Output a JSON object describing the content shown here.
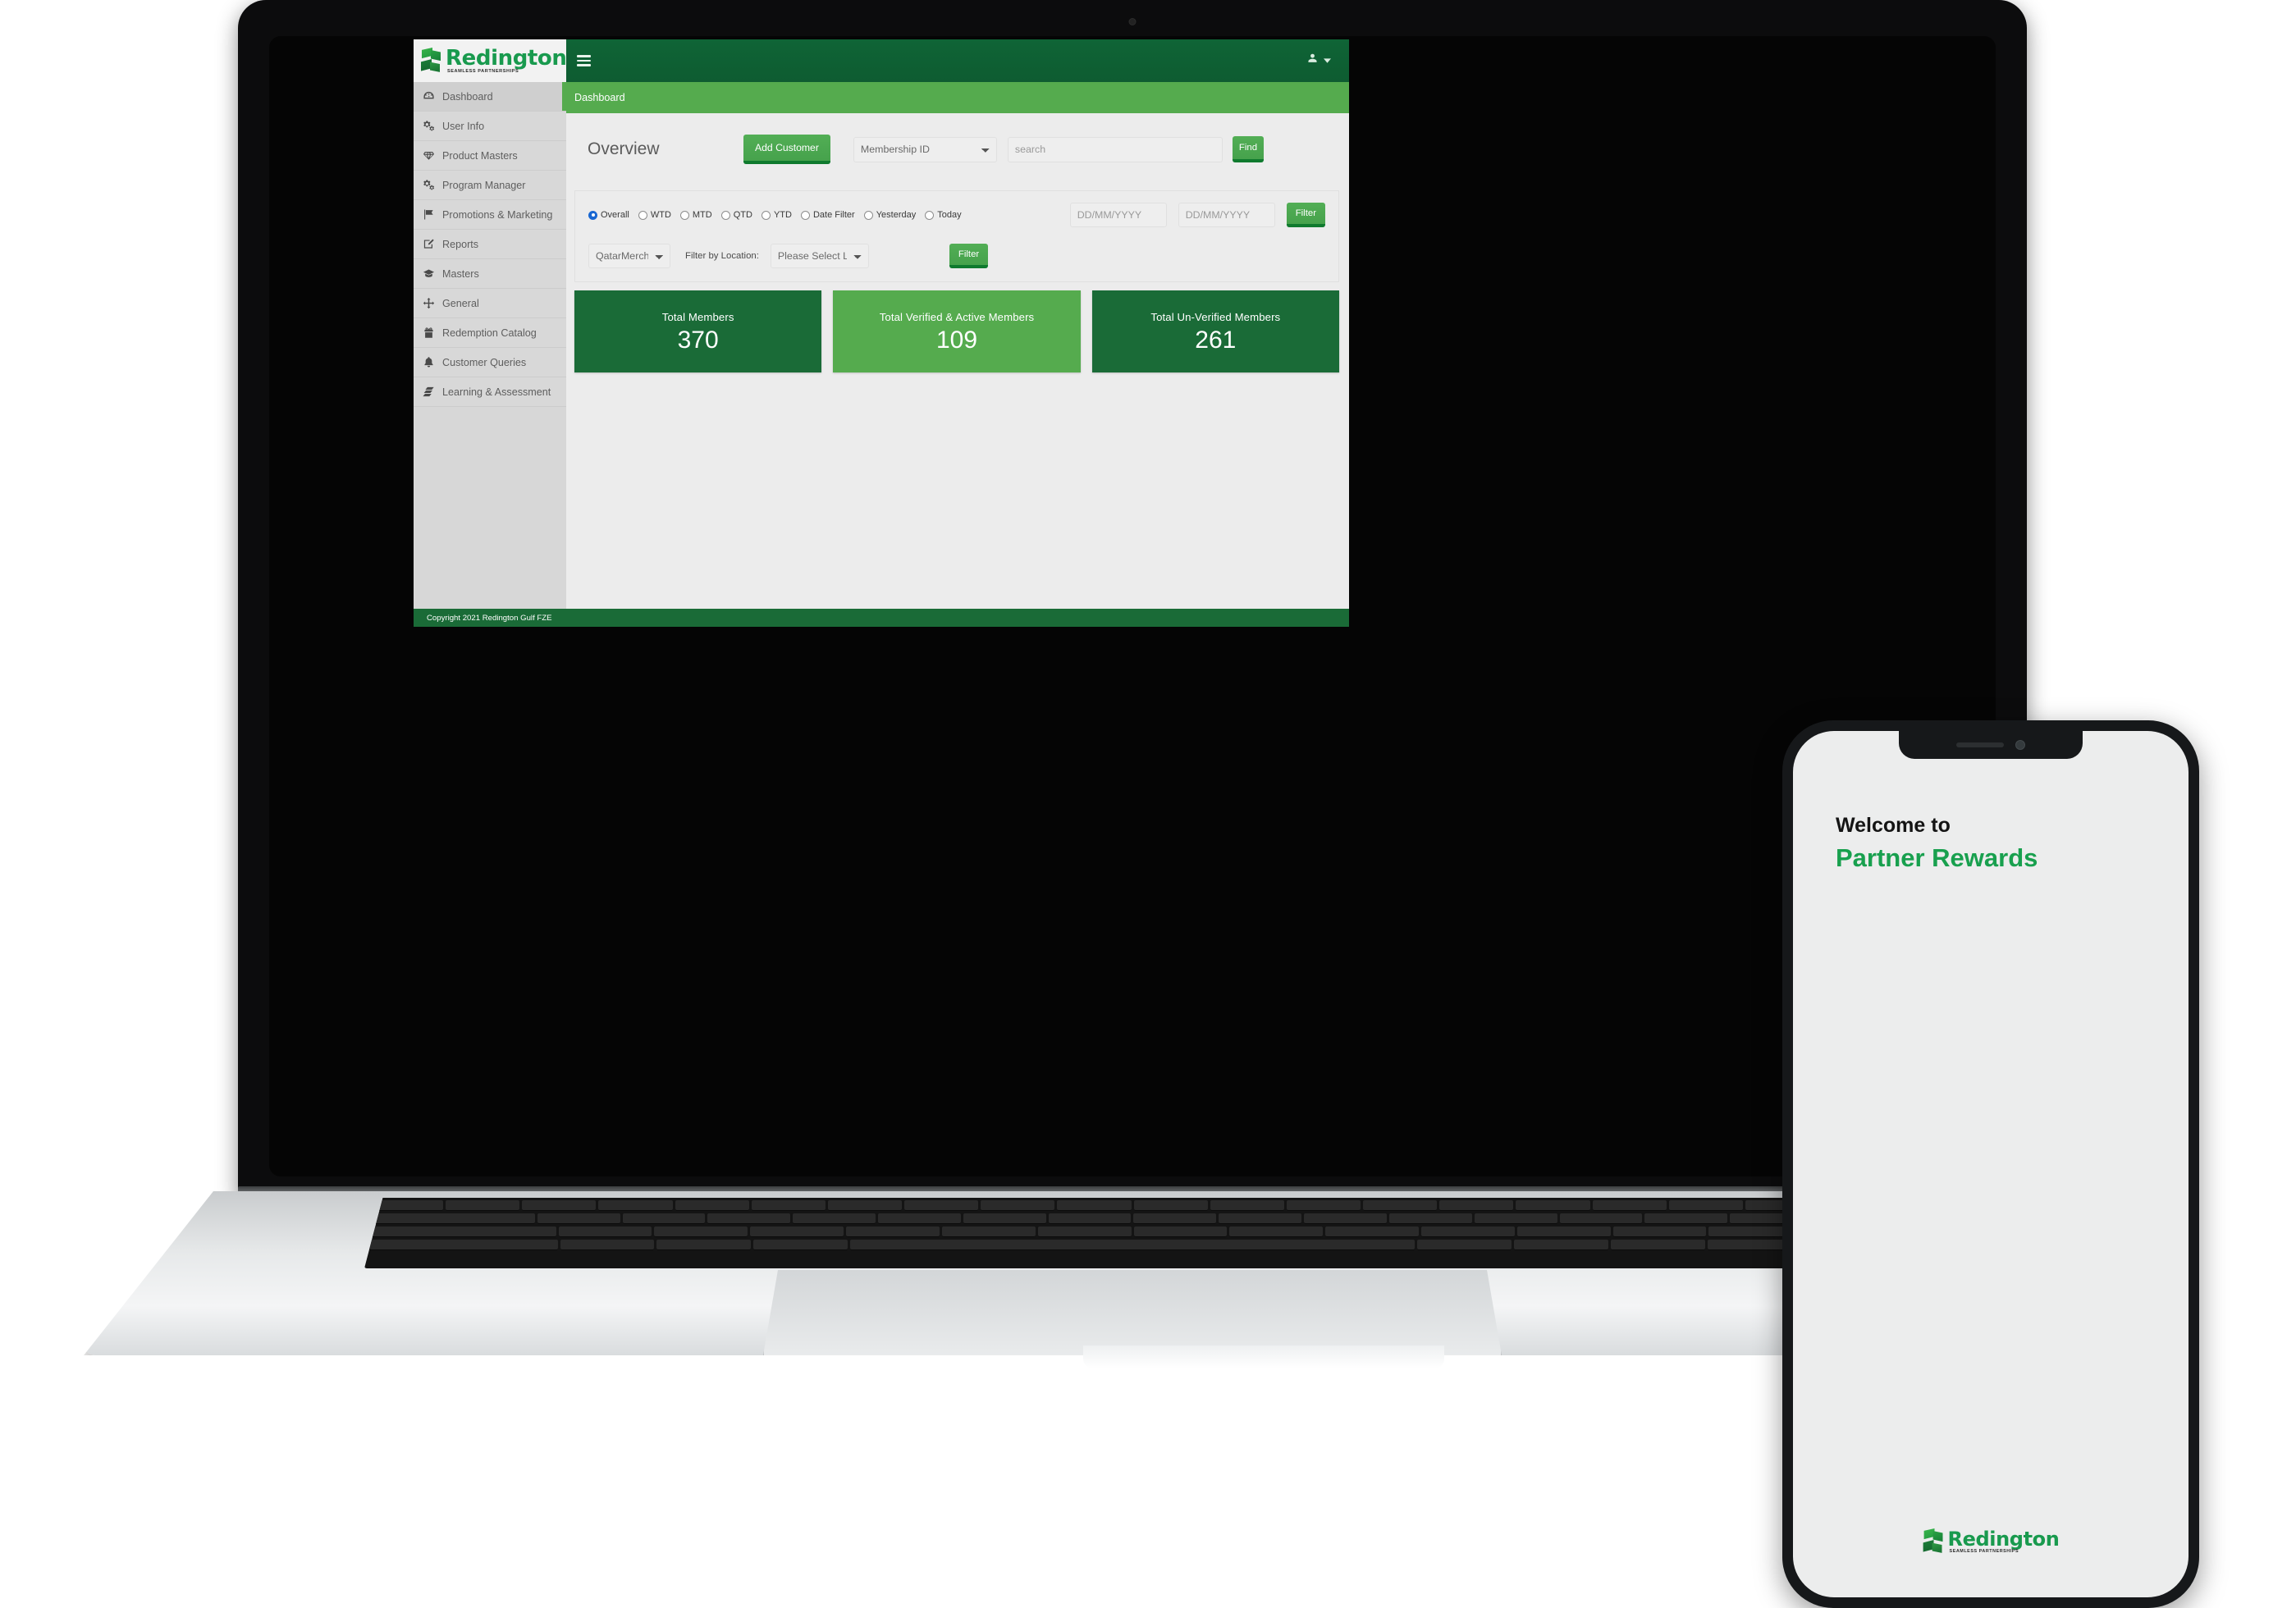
{
  "brand": {
    "name": "Redington",
    "tagline": "SEAMLESS PARTNERSHIPS",
    "mark_icon": "redington-logo-icon"
  },
  "colors": {
    "header_green": "#0f6436",
    "breadcrumb_green": "#55ab4e",
    "accent_green": "#18a04e",
    "card_dark": "#1a6b37",
    "card_light": "#55ab4e",
    "sidebar_bg": "#d7d7d7",
    "page_bg": "#ececec"
  },
  "sidebar": {
    "items": [
      {
        "label": "Dashboard",
        "icon": "dashboard-icon",
        "active": true
      },
      {
        "label": "User Info",
        "icon": "gears-icon",
        "active": false
      },
      {
        "label": "Product Masters",
        "icon": "diamond-icon",
        "active": false
      },
      {
        "label": "Program Manager",
        "icon": "gears-icon",
        "active": false
      },
      {
        "label": "Promotions & Marketing",
        "icon": "flag-icon",
        "active": false
      },
      {
        "label": "Reports",
        "icon": "edit-square-icon",
        "active": false
      },
      {
        "label": "Masters",
        "icon": "graduation-icon",
        "active": false
      },
      {
        "label": "General",
        "icon": "move-arrows-icon",
        "active": false
      },
      {
        "label": "Redemption Catalog",
        "icon": "gift-icon",
        "active": false
      },
      {
        "label": "Customer Queries",
        "icon": "bell-icon",
        "active": false
      },
      {
        "label": "Learning & Assessment",
        "icon": "book-icon",
        "active": false
      }
    ]
  },
  "topbar": {
    "menu_toggle_icon": "hamburger-icon",
    "user_icon": "user-avatar-icon",
    "user_caret_icon": "caret-down-icon"
  },
  "breadcrumb": {
    "label": "Dashboard"
  },
  "overview": {
    "title": "Overview",
    "add_customer_label": "Add Customer",
    "search_type_selected": "Membership ID",
    "search_type_options": [
      "Membership ID"
    ],
    "search_placeholder": "search",
    "search_value": "",
    "find_label": "Find"
  },
  "filters": {
    "period_options": [
      {
        "label": "Overall",
        "selected": true
      },
      {
        "label": "WTD",
        "selected": false
      },
      {
        "label": "MTD",
        "selected": false
      },
      {
        "label": "QTD",
        "selected": false
      },
      {
        "label": "YTD",
        "selected": false
      },
      {
        "label": "Date Filter",
        "selected": false
      },
      {
        "label": "Yesterday",
        "selected": false
      },
      {
        "label": "Today",
        "selected": false
      }
    ],
    "date_from_placeholder": "DD/MM/YYYY",
    "date_from_value": "",
    "date_to_placeholder": "DD/MM/YYYY",
    "date_to_value": "",
    "filter_button_label": "Filter",
    "merchant_selected": "QatarMerchantLive",
    "merchant_options": [
      "QatarMerchantLive"
    ],
    "location_label": "Filter by Location:",
    "location_selected": "Please Select Location",
    "location_options": [
      "Please Select Location"
    ],
    "filter_button_label_2": "Filter"
  },
  "cards": [
    {
      "label": "Total Members",
      "value": "370",
      "style": "dark"
    },
    {
      "label": "Total Verified & Active Members",
      "value": "109",
      "style": "light"
    },
    {
      "label": "Total Un-Verified Members",
      "value": "261",
      "style": "dark"
    }
  ],
  "footer": {
    "copyright": "Copyright 2021 Redington Gulf FZE"
  },
  "phone": {
    "welcome_line1": "Welcome to",
    "welcome_line2": "Partner Rewards",
    "logo_name": "Redington",
    "logo_tagline": "SEAMLESS PARTNERSHIPS"
  }
}
